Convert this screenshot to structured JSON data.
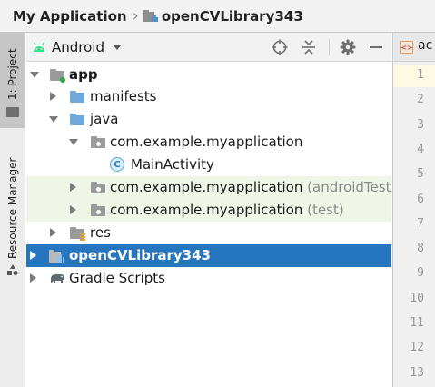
{
  "breadcrumb": {
    "project": "My Application",
    "module": "openCVLibrary343"
  },
  "side_strip": {
    "project_tab": "1: Project",
    "resource_manager_tab": "Resource Manager"
  },
  "toolbar": {
    "view_selector": "Android",
    "icons": [
      "android-icon",
      "dropdown-chevron-icon",
      "locate-target-icon",
      "collapse-all-icon",
      "gear-icon",
      "minimize-icon"
    ]
  },
  "tree": {
    "items": [
      {
        "label": "app",
        "suffix": "",
        "expanded": true
      },
      {
        "label": "manifests",
        "suffix": "",
        "expanded": false
      },
      {
        "label": "java",
        "suffix": "",
        "expanded": true
      },
      {
        "label": "com.example.myapplication",
        "suffix": "",
        "expanded": true
      },
      {
        "label": "MainActivity",
        "suffix": ""
      },
      {
        "label": "com.example.myapplication",
        "suffix": "(androidTest)",
        "expanded": false
      },
      {
        "label": "com.example.myapplication",
        "suffix": "(test)",
        "expanded": false
      },
      {
        "label": "res",
        "suffix": "",
        "expanded": false
      },
      {
        "label": "openCVLibrary343",
        "suffix": "",
        "expanded": false,
        "selected": true
      },
      {
        "label": "Gradle Scripts",
        "suffix": "",
        "expanded": false
      }
    ]
  },
  "editor": {
    "tab_label": "ac",
    "line_numbers": [
      "1",
      "2",
      "3",
      "4",
      "5",
      "6",
      "7",
      "8",
      "9",
      "10",
      "11",
      "12",
      "13"
    ]
  },
  "colors": {
    "selection": "#2675bf",
    "test_highlight": "#eff6e8",
    "folder_blue": "#6fa8dc",
    "android_green": "#3ddc84"
  }
}
